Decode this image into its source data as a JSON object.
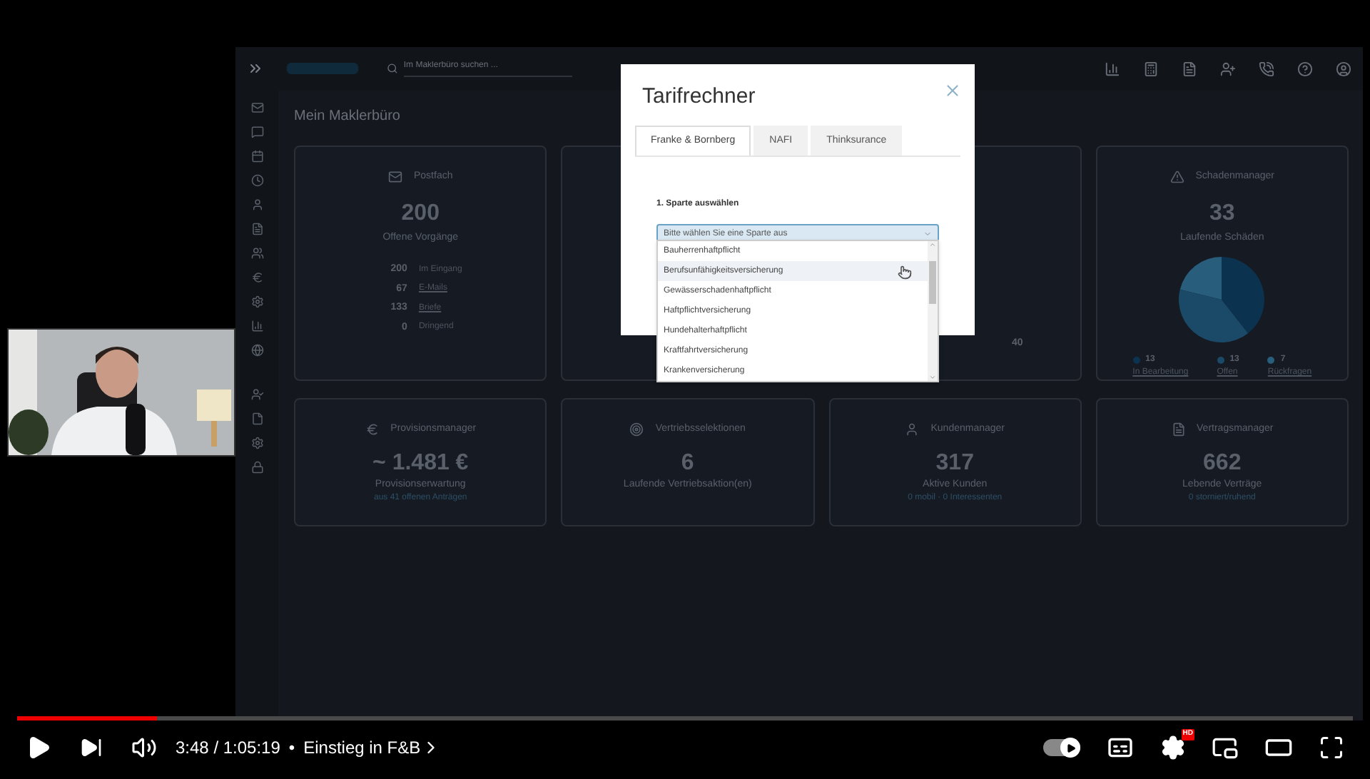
{
  "app": {
    "search": {
      "placeholder": "Im Maklerbüro suchen ..."
    },
    "heading": "Mein Maklerbüro",
    "cards": [
      {
        "kind": "postfach",
        "title": "Postfach",
        "value": "200",
        "caption": "Offene Vorgänge",
        "breakdown": [
          {
            "count": "200",
            "label": "Im Eingang",
            "link": false
          },
          {
            "count": "67",
            "label": "E-Mails",
            "link": true
          },
          {
            "count": "133",
            "label": "Briefe",
            "link": true
          },
          {
            "count": "0",
            "label": "Dringend",
            "link": false
          }
        ]
      },
      {
        "kind": "hidden"
      },
      {
        "kind": "partial",
        "footer": "40"
      },
      {
        "kind": "pie",
        "title": "Schadenmanager",
        "value": "33",
        "caption": "Laufende Schäden",
        "chart_data": {
          "type": "pie",
          "series": [
            {
              "values": [
                39.4,
                39.4,
                21.2
              ]
            }
          ]
        },
        "legend": [
          {
            "count": "13",
            "label": "In Bearbeitung",
            "color": "#0b3350"
          },
          {
            "count": "13",
            "label": "Offen",
            "color": "#1b4a68"
          },
          {
            "count": "7",
            "label": "Rückfragen",
            "color": "#285d7c"
          }
        ]
      },
      {
        "kind": "stat",
        "title": "Provisionsmanager",
        "value": "~ 1.481 €",
        "caption": "Provisionserwartung",
        "note": "aus 41 offenen Anträgen"
      },
      {
        "kind": "stat",
        "title": "Vertriebsselektionen",
        "value": "6",
        "caption": "Laufende Vertriebsaktion(en)"
      },
      {
        "kind": "stat",
        "title": "Kundenmanager",
        "value": "317",
        "caption": "Aktive Kunden",
        "note": "0 mobil · 0 Interessenten"
      },
      {
        "kind": "stat",
        "title": "Vertragsmanager",
        "value": "662",
        "caption": "Lebende Verträge",
        "note": "0 storniert/ruhend"
      }
    ]
  },
  "dialog": {
    "title": "Tarifrechner",
    "tabs": [
      {
        "label": "Franke & Bornberg",
        "selected": true
      },
      {
        "label": "NAFI",
        "selected": false
      },
      {
        "label": "Thinksurance",
        "selected": false
      }
    ],
    "field_label": "1. Sparte auswählen",
    "select": {
      "value": "Bitte wählen Sie eine Sparte aus"
    },
    "options": [
      {
        "label": "Bauherrenhaftpflicht",
        "highlighted": false
      },
      {
        "label": "Berufsunfähigkeitsversicherung",
        "highlighted": true
      },
      {
        "label": "Gewässerschadenhaftpflicht",
        "highlighted": false
      },
      {
        "label": "Haftpflichtversicherung",
        "highlighted": false
      },
      {
        "label": "Hundehalterhaftpflicht",
        "highlighted": false
      },
      {
        "label": "Kraftfahrtversicherung",
        "highlighted": false
      },
      {
        "label": "Krankenversicherung",
        "highlighted": false
      }
    ]
  },
  "player": {
    "progress": {
      "level": 0.105
    },
    "autoplay": {
      "on": true
    },
    "time": "3:48 / 1:05:19",
    "separator": "•",
    "chapter": "Einstieg in F&B",
    "settings_badge": "HD"
  }
}
